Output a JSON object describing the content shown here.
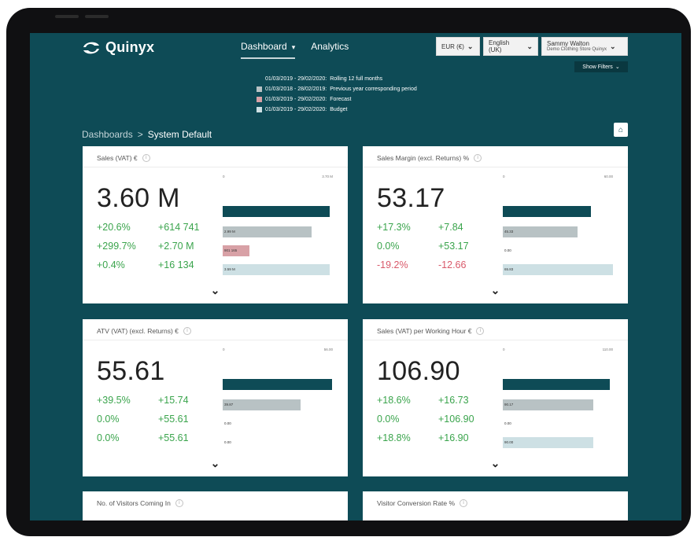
{
  "app": {
    "logo_text": "Quinyx",
    "nav": [
      {
        "label": "Dashboard",
        "caret": "▾"
      },
      {
        "label": "Analytics"
      }
    ],
    "currency": "EUR (€)",
    "language": "English (UK)",
    "user": {
      "name": "Sammy Walton",
      "store": "Demo Clothing Store Quinyx"
    },
    "show_filters": "Show Filters"
  },
  "legend": [
    {
      "dates": "01/03/2019 - 29/02/2020:",
      "label": "Rolling 12 full months",
      "color": "#0e4b56"
    },
    {
      "dates": "01/03/2018 - 28/02/2019:",
      "label": "Previous year corresponding period",
      "color": "#b8c2c4"
    },
    {
      "dates": "01/03/2019 - 29/02/2020:",
      "label": "Forecast",
      "color": "#d8a1a6"
    },
    {
      "dates": "01/03/2019 - 29/02/2020:",
      "label": "Budget",
      "color": "#cde0e4"
    }
  ],
  "breadcrumb": {
    "root": "Dashboards",
    "separator": ">",
    "current": "System Default"
  },
  "colors": {
    "primary": "#0e4b56",
    "previous": "#b8c2c4",
    "forecast": "#d8a1a6",
    "budget": "#cde0e4",
    "positive": "#3aa44c",
    "negative": "#d9596a"
  },
  "cards": [
    {
      "title": "Sales (VAT) €",
      "value": "3.60 M",
      "axis_min": "0",
      "axis_max": "3.70 M",
      "stats": [
        {
          "pct": "+20.6%",
          "abs": "+614 741",
          "tone": "pos"
        },
        {
          "pct": "+299.7%",
          "abs": "+2.70 M",
          "tone": "pos"
        },
        {
          "pct": "+0.4%",
          "abs": "+16 134",
          "tone": "pos"
        }
      ],
      "bars": [
        {
          "fraction": 0.97,
          "label": ""
        },
        {
          "fraction": 0.81,
          "label": "2.99 M"
        },
        {
          "fraction": 0.24,
          "label": "901 165"
        },
        {
          "fraction": 0.97,
          "label": "3.59 M"
        }
      ]
    },
    {
      "title": "Sales Margin (excl. Returns) %",
      "value": "53.17",
      "axis_min": "0",
      "axis_max": "60.00",
      "stats": [
        {
          "pct": "+17.3%",
          "abs": "+7.84",
          "tone": "pos"
        },
        {
          "pct": "0.0%",
          "abs": "+53.17",
          "tone": "pos"
        },
        {
          "pct": "-19.2%",
          "abs": "-12.66",
          "tone": "neg"
        }
      ],
      "bars": [
        {
          "fraction": 0.8,
          "label": ""
        },
        {
          "fraction": 0.68,
          "label": "45.33"
        },
        {
          "fraction": 0.0,
          "label": "0.00"
        },
        {
          "fraction": 1.0,
          "label": "65.83"
        }
      ]
    },
    {
      "title": "ATV (VAT) (excl. Returns) €",
      "value": "55.61",
      "axis_min": "0",
      "axis_max": "56.00",
      "stats": [
        {
          "pct": "+39.5%",
          "abs": "+15.74",
          "tone": "pos"
        },
        {
          "pct": "0.0%",
          "abs": "+55.61",
          "tone": "pos"
        },
        {
          "pct": "0.0%",
          "abs": "+55.61",
          "tone": "pos"
        }
      ],
      "bars": [
        {
          "fraction": 0.99,
          "label": ""
        },
        {
          "fraction": 0.71,
          "label": "39.87"
        },
        {
          "fraction": 0.0,
          "label": "0.00"
        },
        {
          "fraction": 0.0,
          "label": "0.00"
        }
      ]
    },
    {
      "title": "Sales (VAT) per Working Hour €",
      "value": "106.90",
      "axis_min": "0",
      "axis_max": "110.00",
      "stats": [
        {
          "pct": "+18.6%",
          "abs": "+16.73",
          "tone": "pos"
        },
        {
          "pct": "0.0%",
          "abs": "+106.90",
          "tone": "pos"
        },
        {
          "pct": "+18.8%",
          "abs": "+16.90",
          "tone": "pos"
        }
      ],
      "bars": [
        {
          "fraction": 0.97,
          "label": ""
        },
        {
          "fraction": 0.82,
          "label": "90.17"
        },
        {
          "fraction": 0.0,
          "label": "0.00"
        },
        {
          "fraction": 0.82,
          "label": "90.00"
        }
      ]
    },
    {
      "title": "No. of Visitors Coming In"
    },
    {
      "title": "Visitor Conversion Rate %"
    }
  ]
}
